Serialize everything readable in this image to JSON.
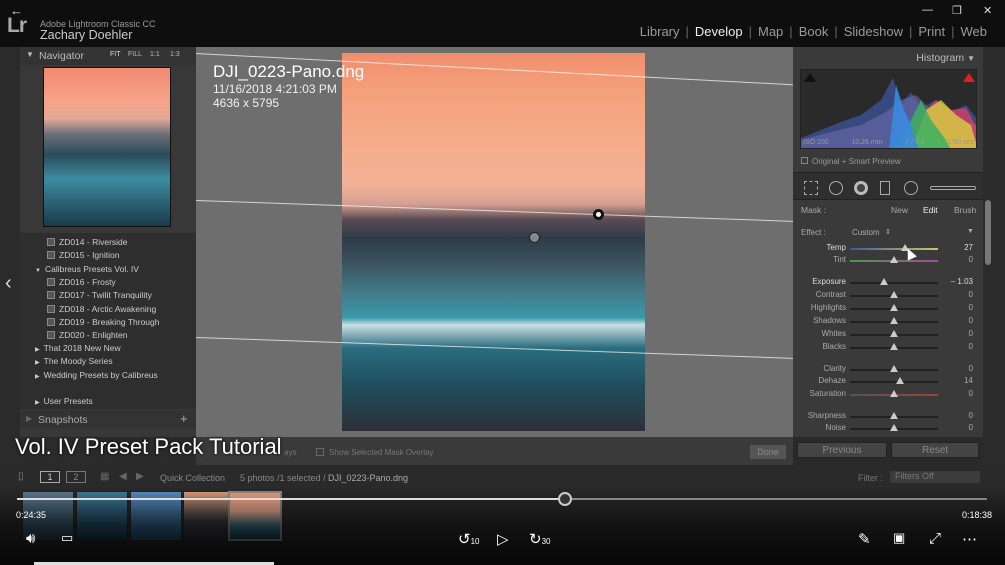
{
  "app": {
    "name": "Adobe Lightroom Classic CC",
    "user": "Zachary Doehler",
    "logo": "Lr"
  },
  "modules": [
    "Library",
    "Develop",
    "Map",
    "Book",
    "Slideshow",
    "Print",
    "Web"
  ],
  "active_module": "Develop",
  "navigator": {
    "title": "Navigator",
    "zoom_options": [
      "FIT",
      "FILL",
      "1:1",
      "1:3"
    ]
  },
  "presets": [
    {
      "label": "ZD014 - Riverside",
      "type": "item"
    },
    {
      "label": "ZD015 - Ignition",
      "type": "item"
    },
    {
      "label": "Calibreus Presets Vol. IV",
      "type": "folder-open"
    },
    {
      "label": "ZD016 - Frosty",
      "type": "item"
    },
    {
      "label": "ZD017 - Twilit Tranquility",
      "type": "item"
    },
    {
      "label": "ZD018 - Arctic Awakening",
      "type": "item"
    },
    {
      "label": "ZD019 - Breaking Through",
      "type": "item"
    },
    {
      "label": "ZD020 - Enlighten",
      "type": "item"
    },
    {
      "label": "That 2018 New New",
      "type": "folder"
    },
    {
      "label": "The Moody Series",
      "type": "folder"
    },
    {
      "label": "Wedding Presets by Calibreus",
      "type": "folder"
    },
    {
      "label": "User Presets",
      "type": "folder"
    }
  ],
  "snapshots": {
    "title": "Snapshots",
    "add": "+"
  },
  "photo": {
    "filename": "DJI_0223-Pano.dng",
    "datetime": "11/16/2018 4:21:03 PM",
    "dimensions": "4636 x 5795"
  },
  "histogram": {
    "title": "Histogram",
    "iso": "ISO 100",
    "focal": "10.26 mm",
    "aperture": "ƒ / 5.6",
    "shutter": "1/60 sec",
    "preview": "Original + Smart Preview"
  },
  "mask": {
    "label": "Mask :",
    "new": "New",
    "edit": "Edit",
    "brush": "Brush"
  },
  "effect": {
    "label": "Effect :",
    "value": "Custom"
  },
  "sliders": [
    {
      "label": "Temp",
      "value": "27",
      "pos": 0.62,
      "bright": true
    },
    {
      "label": "Tint",
      "value": "0",
      "pos": 0.5
    },
    {
      "label": "Exposure",
      "value": "– 1.03",
      "pos": 0.39,
      "bright": true
    },
    {
      "label": "Contrast",
      "value": "0",
      "pos": 0.5
    },
    {
      "label": "Highlights",
      "value": "0",
      "pos": 0.5
    },
    {
      "label": "Shadows",
      "value": "0",
      "pos": 0.5
    },
    {
      "label": "Whites",
      "value": "0",
      "pos": 0.5
    },
    {
      "label": "Blacks",
      "value": "0",
      "pos": 0.5
    },
    {
      "label": "Clarity",
      "value": "0",
      "pos": 0.5
    },
    {
      "label": "Dehaze",
      "value": "14",
      "pos": 0.57
    },
    {
      "label": "Saturation",
      "value": "0",
      "pos": 0.5
    },
    {
      "label": "Sharpness",
      "value": "0",
      "pos": 0.5
    },
    {
      "label": "Noise",
      "value": "0",
      "pos": 0.5
    }
  ],
  "buttons": {
    "previous": "Previous",
    "reset": "Reset",
    "done": "Done"
  },
  "toolbar": {
    "overlay": "Show Selected Mask Overlay",
    "ays": "ays"
  },
  "filmbar": {
    "pages": [
      "1",
      "2"
    ],
    "source": "Quick Collection",
    "count": "5 photos /1 selected /",
    "selected_file": "DJI_0223-Pano.dng",
    "filter_label": "Filter :",
    "filter_value": "Filters Off"
  },
  "caption": "Vol. IV Preset Pack Tutorial",
  "video": {
    "current": "0:24:35",
    "duration": "0:18:38",
    "progress": 0.565,
    "rewind": "10",
    "forward": "30"
  }
}
